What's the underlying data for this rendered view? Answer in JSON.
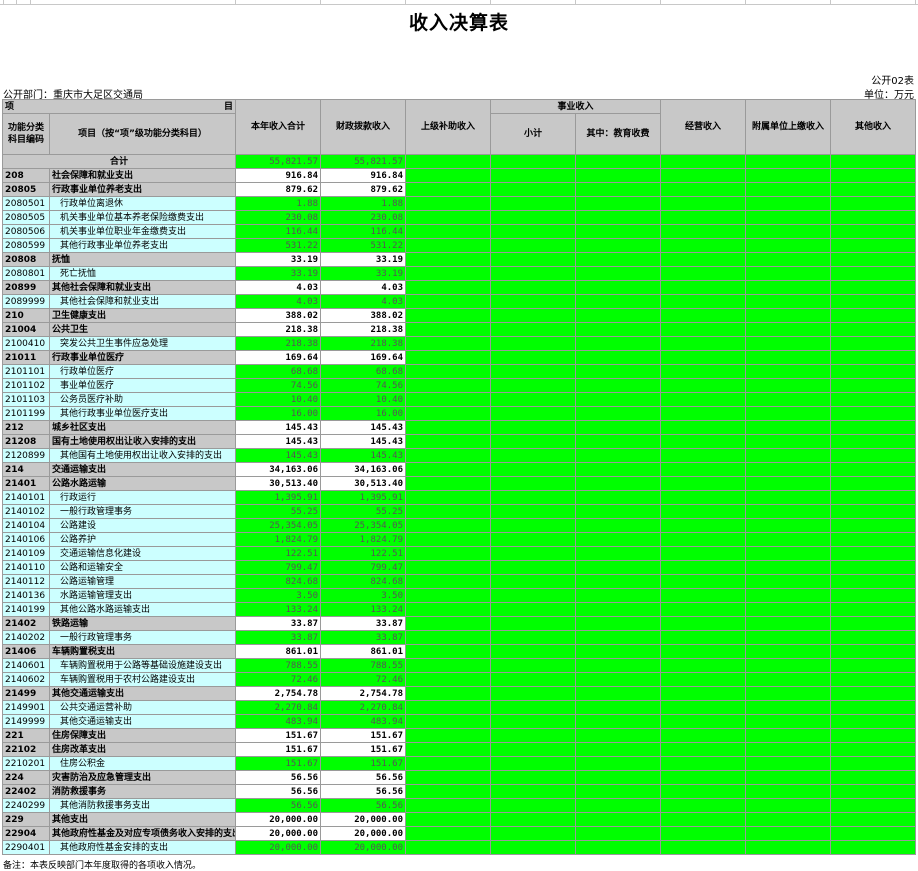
{
  "title": "收入决算表",
  "form_code": "公开02表",
  "department": "公开部门：重庆市大足区交通局",
  "unit": "单位：万元",
  "headers": {
    "item_top": "项",
    "item_top_right": "目",
    "code": "功能分类科目编码",
    "name": "项目（按“项”级功能分类科目）",
    "total_income": "本年收入合计",
    "fiscal": "财政拨款收入",
    "subsidy": "上级补助收入",
    "career_group": "事业收入",
    "career_sub": "小计",
    "career_edu": "其中：教育收费",
    "business": "经营收入",
    "affiliated": "附属单位上缴收入",
    "other": "其他收入"
  },
  "total_row": {
    "label": "合计",
    "total": "55,821.57",
    "fiscal": "55,821.57"
  },
  "rows": [
    {
      "level": 1,
      "code": "208",
      "name": "社会保障和就业支出",
      "total": "916.84",
      "fiscal": "916.84"
    },
    {
      "level": 2,
      "code": "20805",
      "name": "行政事业单位养老支出",
      "total": "879.62",
      "fiscal": "879.62"
    },
    {
      "level": 3,
      "code": "2080501",
      "name": "行政单位离退休",
      "total": "1.88",
      "fiscal": "1.88"
    },
    {
      "level": 3,
      "code": "2080505",
      "name": "机关事业单位基本养老保险缴费支出",
      "total": "230.08",
      "fiscal": "230.08"
    },
    {
      "level": 3,
      "code": "2080506",
      "name": "机关事业单位职业年金缴费支出",
      "total": "116.44",
      "fiscal": "116.44"
    },
    {
      "level": 3,
      "code": "2080599",
      "name": "其他行政事业单位养老支出",
      "total": "531.22",
      "fiscal": "531.22"
    },
    {
      "level": 2,
      "code": "20808",
      "name": "抚恤",
      "total": "33.19",
      "fiscal": "33.19"
    },
    {
      "level": 3,
      "code": "2080801",
      "name": "死亡抚恤",
      "total": "33.19",
      "fiscal": "33.19"
    },
    {
      "level": 2,
      "code": "20899",
      "name": "其他社会保障和就业支出",
      "total": "4.03",
      "fiscal": "4.03"
    },
    {
      "level": 3,
      "code": "2089999",
      "name": "其他社会保障和就业支出",
      "total": "4.03",
      "fiscal": "4.03"
    },
    {
      "level": 1,
      "code": "210",
      "name": "卫生健康支出",
      "total": "388.02",
      "fiscal": "388.02"
    },
    {
      "level": 2,
      "code": "21004",
      "name": "公共卫生",
      "total": "218.38",
      "fiscal": "218.38"
    },
    {
      "level": 3,
      "code": "2100410",
      "name": "突发公共卫生事件应急处理",
      "total": "218.38",
      "fiscal": "218.38"
    },
    {
      "level": 2,
      "code": "21011",
      "name": "行政事业单位医疗",
      "total": "169.64",
      "fiscal": "169.64"
    },
    {
      "level": 3,
      "code": "2101101",
      "name": "行政单位医疗",
      "total": "68.68",
      "fiscal": "68.68"
    },
    {
      "level": 3,
      "code": "2101102",
      "name": "事业单位医疗",
      "total": "74.56",
      "fiscal": "74.56"
    },
    {
      "level": 3,
      "code": "2101103",
      "name": "公务员医疗补助",
      "total": "10.40",
      "fiscal": "10.40"
    },
    {
      "level": 3,
      "code": "2101199",
      "name": "其他行政事业单位医疗支出",
      "total": "16.00",
      "fiscal": "16.00"
    },
    {
      "level": 1,
      "code": "212",
      "name": "城乡社区支出",
      "total": "145.43",
      "fiscal": "145.43"
    },
    {
      "level": 2,
      "code": "21208",
      "name": "国有土地使用权出让收入安排的支出",
      "total": "145.43",
      "fiscal": "145.43"
    },
    {
      "level": 3,
      "code": "2120899",
      "name": "其他国有土地使用权出让收入安排的支出",
      "total": "145.43",
      "fiscal": "145.43"
    },
    {
      "level": 1,
      "code": "214",
      "name": "交通运输支出",
      "total": "34,163.06",
      "fiscal": "34,163.06"
    },
    {
      "level": 2,
      "code": "21401",
      "name": "公路水路运输",
      "total": "30,513.40",
      "fiscal": "30,513.40"
    },
    {
      "level": 3,
      "code": "2140101",
      "name": "行政运行",
      "total": "1,395.91",
      "fiscal": "1,395.91"
    },
    {
      "level": 3,
      "code": "2140102",
      "name": "一般行政管理事务",
      "total": "55.25",
      "fiscal": "55.25"
    },
    {
      "level": 3,
      "code": "2140104",
      "name": "公路建设",
      "total": "25,354.05",
      "fiscal": "25,354.05"
    },
    {
      "level": 3,
      "code": "2140106",
      "name": "公路养护",
      "total": "1,824.79",
      "fiscal": "1,824.79"
    },
    {
      "level": 3,
      "code": "2140109",
      "name": "交通运输信息化建设",
      "total": "122.51",
      "fiscal": "122.51"
    },
    {
      "level": 3,
      "code": "2140110",
      "name": "公路和运输安全",
      "total": "799.47",
      "fiscal": "799.47"
    },
    {
      "level": 3,
      "code": "2140112",
      "name": "公路运输管理",
      "total": "824.68",
      "fiscal": "824.68"
    },
    {
      "level": 3,
      "code": "2140136",
      "name": "水路运输管理支出",
      "total": "3.50",
      "fiscal": "3.50"
    },
    {
      "level": 3,
      "code": "2140199",
      "name": "其他公路水路运输支出",
      "total": "133.24",
      "fiscal": "133.24"
    },
    {
      "level": 2,
      "code": "21402",
      "name": "铁路运输",
      "total": "33.87",
      "fiscal": "33.87"
    },
    {
      "level": 3,
      "code": "2140202",
      "name": "一般行政管理事务",
      "total": "33.87",
      "fiscal": "33.87"
    },
    {
      "level": 2,
      "code": "21406",
      "name": "车辆购置税支出",
      "total": "861.01",
      "fiscal": "861.01"
    },
    {
      "level": 3,
      "code": "2140601",
      "name": "车辆购置税用于公路等基础设施建设支出",
      "total": "788.55",
      "fiscal": "788.55"
    },
    {
      "level": 3,
      "code": "2140602",
      "name": "车辆购置税用于农村公路建设支出",
      "total": "72.46",
      "fiscal": "72.46"
    },
    {
      "level": 2,
      "code": "21499",
      "name": "其他交通运输支出",
      "total": "2,754.78",
      "fiscal": "2,754.78"
    },
    {
      "level": 3,
      "code": "2149901",
      "name": "公共交通运营补助",
      "total": "2,270.84",
      "fiscal": "2,270.84"
    },
    {
      "level": 3,
      "code": "2149999",
      "name": "其他交通运输支出",
      "total": "483.94",
      "fiscal": "483.94"
    },
    {
      "level": 1,
      "code": "221",
      "name": "住房保障支出",
      "total": "151.67",
      "fiscal": "151.67"
    },
    {
      "level": 2,
      "code": "22102",
      "name": "住房改革支出",
      "total": "151.67",
      "fiscal": "151.67"
    },
    {
      "level": 3,
      "code": "2210201",
      "name": "住房公积金",
      "total": "151.67",
      "fiscal": "151.67"
    },
    {
      "level": 1,
      "code": "224",
      "name": "灾害防治及应急管理支出",
      "total": "56.56",
      "fiscal": "56.56"
    },
    {
      "level": 2,
      "code": "22402",
      "name": "消防救援事务",
      "total": "56.56",
      "fiscal": "56.56"
    },
    {
      "level": 3,
      "code": "2240299",
      "name": "其他消防救援事务支出",
      "total": "56.56",
      "fiscal": "56.56"
    },
    {
      "level": 1,
      "code": "229",
      "name": "其他支出",
      "total": "20,000.00",
      "fiscal": "20,000.00"
    },
    {
      "level": 2,
      "code": "22904",
      "name": "其他政府性基金及对应专项债务收入安排的支出",
      "total": "20,000.00",
      "fiscal": "20,000.00"
    },
    {
      "level": 3,
      "code": "2290401",
      "name": "其他政府性基金安排的支出",
      "total": "20,000.00",
      "fiscal": "20,000.00"
    }
  ],
  "note": "备注：本表反映部门本年度取得的各项收入情况。"
}
